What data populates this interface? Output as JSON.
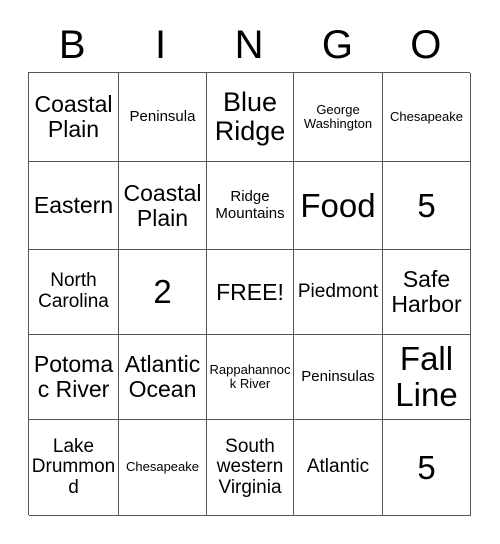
{
  "card": {
    "title_letters": [
      "B",
      "I",
      "N",
      "G",
      "O"
    ],
    "free_space_label": "FREE!",
    "grid_line_color": "#555555",
    "text_color": "#000000",
    "background_color": "#ffffff",
    "rows": 5,
    "columns": 5,
    "cells": [
      [
        {
          "text": "Coastal Plain",
          "size": "fs-l"
        },
        {
          "text": "Peninsula",
          "size": "fs-s"
        },
        {
          "text": "Blue Ridge",
          "size": "fs-xl"
        },
        {
          "text": "George Washington",
          "size": "fs-xs"
        },
        {
          "text": "Chesapeake",
          "size": "fs-xs"
        }
      ],
      [
        {
          "text": "Eastern",
          "size": "fs-l"
        },
        {
          "text": "Coastal Plain",
          "size": "fs-l"
        },
        {
          "text": "Ridge Mountains",
          "size": "fs-s"
        },
        {
          "text": "Food",
          "size": "fs-xxl"
        },
        {
          "text": "5",
          "size": "fs-xxl"
        }
      ],
      [
        {
          "text": "North Carolina",
          "size": "fs-m"
        },
        {
          "text": "2",
          "size": "fs-xxl"
        },
        {
          "text": "FREE!",
          "size": "fs-l"
        },
        {
          "text": "Piedmont",
          "size": "fs-m"
        },
        {
          "text": "Safe Harbor",
          "size": "fs-l"
        }
      ],
      [
        {
          "text": "Potomac River",
          "size": "fs-l"
        },
        {
          "text": "Atlantic Ocean",
          "size": "fs-l"
        },
        {
          "text": "Rappahannock River",
          "size": "fs-xs"
        },
        {
          "text": "Peninsulas",
          "size": "fs-s"
        },
        {
          "text": "Fall Line",
          "size": "fs-xxl"
        }
      ],
      [
        {
          "text": "Lake Drummond",
          "size": "fs-m"
        },
        {
          "text": "Chesapeake",
          "size": "fs-xs"
        },
        {
          "text": "South western Virginia",
          "size": "fs-m"
        },
        {
          "text": "Atlantic",
          "size": "fs-m"
        },
        {
          "text": "5",
          "size": "fs-xxl"
        }
      ]
    ]
  }
}
